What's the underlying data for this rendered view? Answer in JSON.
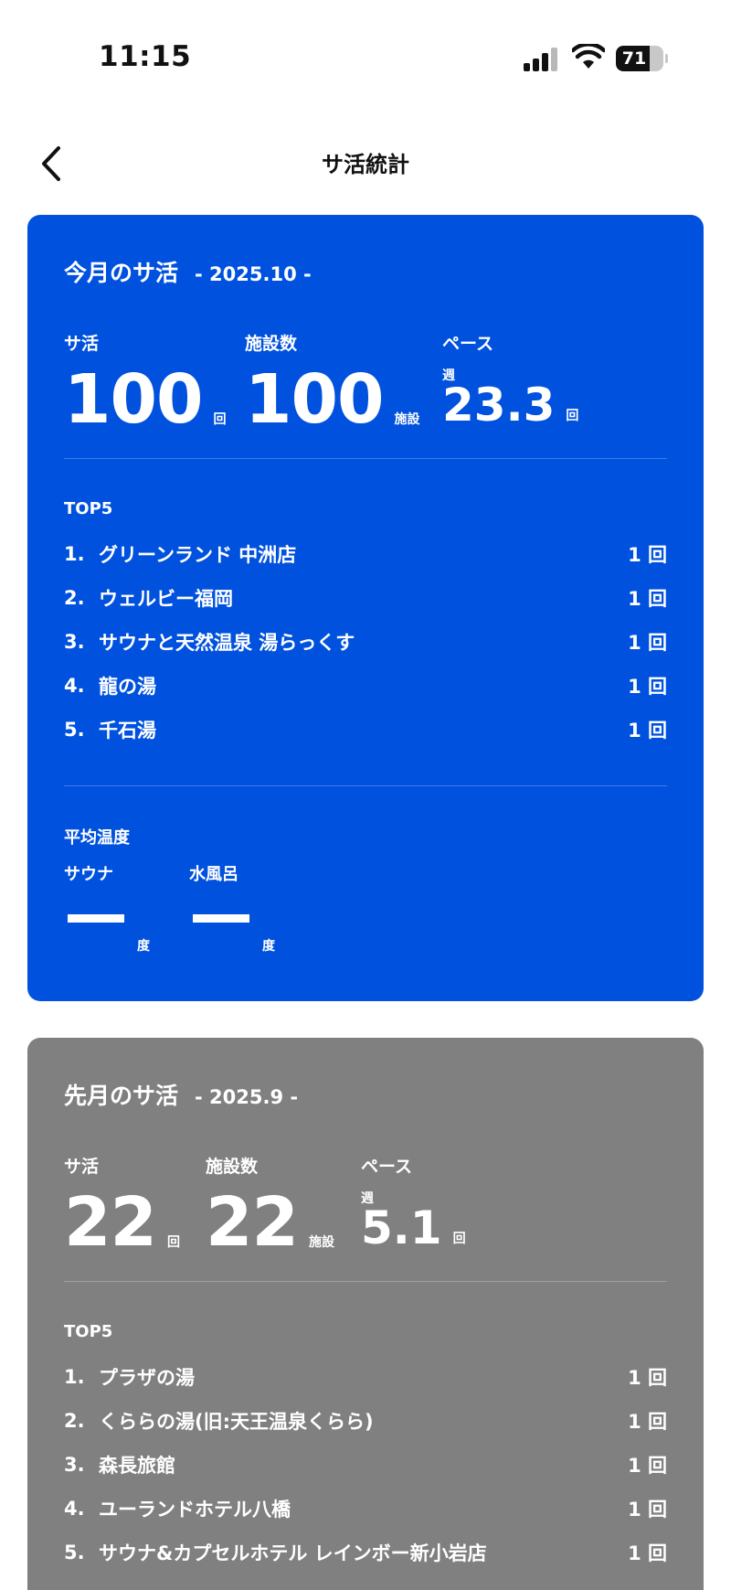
{
  "status_bar": {
    "time": "11:15",
    "battery": "71",
    "battery_level": 0.71
  },
  "header": {
    "title": "サ活統計"
  },
  "current": {
    "title": "今月のサ活",
    "period": "- 2025.10 -",
    "visits_label": "サ活",
    "visits": "100",
    "visits_unit": "回",
    "facilities_label": "施設数",
    "facilities": "100",
    "facilities_unit": "施設",
    "pace_label": "ペース",
    "pace_week": "週",
    "pace": "23.3",
    "pace_unit": "回",
    "top_label": "TOP5",
    "top": [
      {
        "rank": "1.",
        "name": "グリーンランド 中洲店",
        "count": "1 回"
      },
      {
        "rank": "2.",
        "name": "ウェルビー福岡",
        "count": "1 回"
      },
      {
        "rank": "3.",
        "name": "サウナと天然温泉 湯らっくす",
        "count": "1 回"
      },
      {
        "rank": "4.",
        "name": "龍の湯",
        "count": "1 回"
      },
      {
        "rank": "5.",
        "name": "千石湯",
        "count": "1 回"
      }
    ],
    "avg_label": "平均温度",
    "sauna_label": "サウナ",
    "water_label": "水風呂",
    "temp_unit": "度"
  },
  "previous": {
    "title": "先月のサ活",
    "period": "- 2025.9 -",
    "visits_label": "サ活",
    "visits": "22",
    "visits_unit": "回",
    "facilities_label": "施設数",
    "facilities": "22",
    "facilities_unit": "施設",
    "pace_label": "ペース",
    "pace_week": "週",
    "pace": "5.1",
    "pace_unit": "回",
    "top_label": "TOP5",
    "top": [
      {
        "rank": "1.",
        "name": "プラザの湯",
        "count": "1 回"
      },
      {
        "rank": "2.",
        "name": "くららの湯(旧:天王温泉くらら)",
        "count": "1 回"
      },
      {
        "rank": "3.",
        "name": "森長旅館",
        "count": "1 回"
      },
      {
        "rank": "4.",
        "name": "ユーランドホテル八橋",
        "count": "1 回"
      },
      {
        "rank": "5.",
        "name": "サウナ&カプセルホテル レインボー新小岩店",
        "count": "1 回"
      }
    ]
  },
  "colors": {
    "current_card": "#0052de",
    "previous_card": "#808080"
  }
}
